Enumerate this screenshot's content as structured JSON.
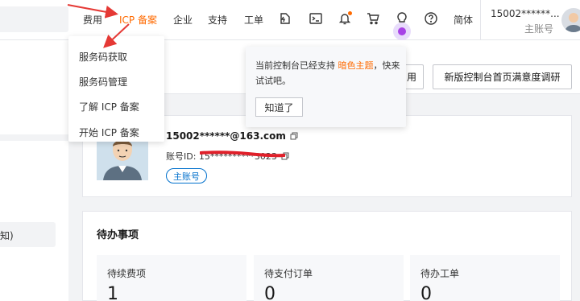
{
  "nav": {
    "fee": "费用",
    "icp": "ICP 备案",
    "enterprise": "企业",
    "support": "支持",
    "ticket": "工单",
    "lang": "简体"
  },
  "nav_icons": [
    "ai-assistant-icon",
    "terminal-icon",
    "bell-icon",
    "cart-icon",
    "bulb-icon",
    "help-icon"
  ],
  "user": {
    "name": "15002******...",
    "role": "主账号"
  },
  "icp_menu": {
    "items": [
      "服务码获取",
      "服务码管理",
      "了解 ICP 备案",
      "开始 ICP 备案"
    ]
  },
  "popover": {
    "text_before": "当前控制台已经支持 ",
    "highlight": "暗色主题",
    "text_after": "，快来试试吧。",
    "button": "知道了"
  },
  "header": {
    "partial_button": "用",
    "survey_button": "新版控制台首页满意度调研"
  },
  "left": {
    "partial_text": "知)"
  },
  "account": {
    "email": "15002******@163.com",
    "id_label": "账号ID: ",
    "id_value": "15**********3023",
    "badge": "主账号"
  },
  "todo": {
    "title": "待办事项",
    "stats": [
      {
        "label": "待续费项",
        "value": "1"
      },
      {
        "label": "待支付订单",
        "value": "0"
      },
      {
        "label": "待办工单",
        "value": "0"
      }
    ]
  },
  "colors": {
    "accent": "#ff6a00",
    "link": "#0070cc",
    "annotation": "#e53935",
    "bulb": "#a742e6"
  }
}
